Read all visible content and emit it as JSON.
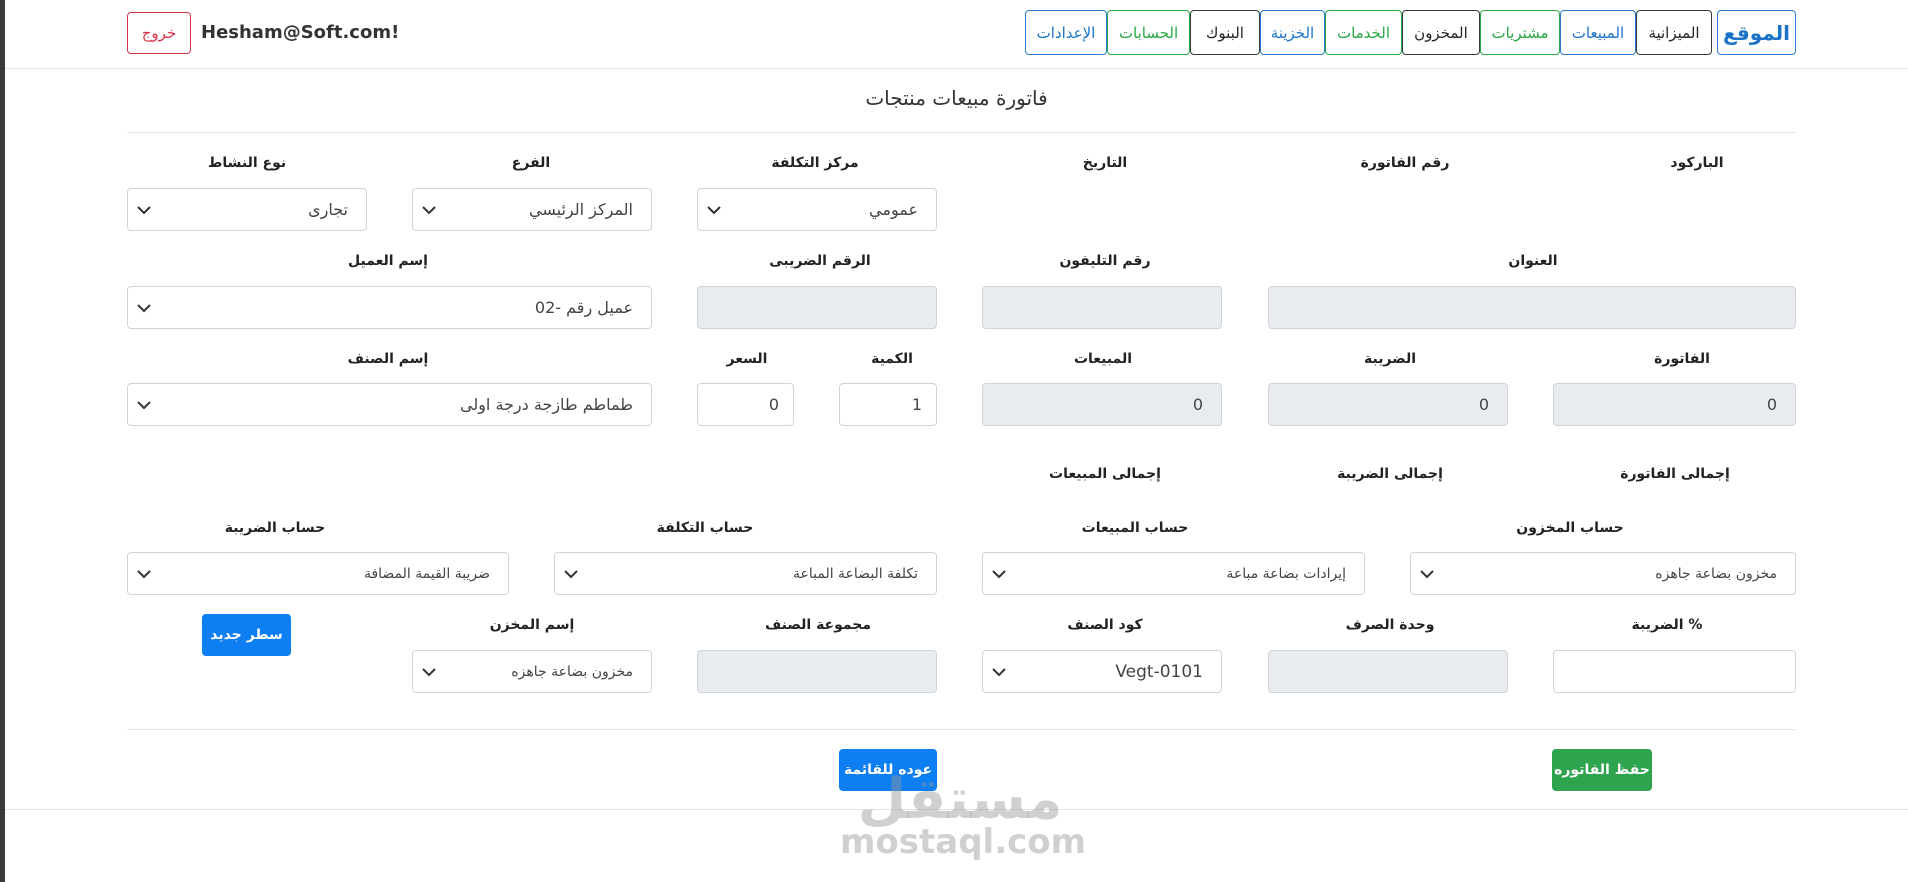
{
  "header": {
    "brand": "الموقع",
    "nav": [
      {
        "label": "الميزانية",
        "name": "nav-budget"
      },
      {
        "label": "المبيعات",
        "name": "nav-sales"
      },
      {
        "label": "مشتريات",
        "name": "nav-purchases"
      },
      {
        "label": "المخزون",
        "name": "nav-inventory"
      },
      {
        "label": "الخدمات",
        "name": "nav-services"
      },
      {
        "label": "الخزينة",
        "name": "nav-treasury"
      },
      {
        "label": "البنوك",
        "name": "nav-banks"
      },
      {
        "label": "الحسابات",
        "name": "nav-accounts"
      },
      {
        "label": "الإعدادات",
        "name": "nav-settings"
      }
    ],
    "user_email": "Hesham@Soft.com!",
    "logout_label": "خروج"
  },
  "form": {
    "title": "فاتورة مبيعات منتجات",
    "labels": {
      "barcode": "الباركود",
      "invoice_number": "رقم الفاتورة",
      "date": "التاريخ",
      "cost_center": "مركز التكلفة",
      "branch": "الفرع",
      "activity_type": "نوع النشاط",
      "address": "العنوان",
      "phone": "رقم التليفون",
      "tax_number": "الرقم الضريبى",
      "customer_name": "إسم العميل",
      "invoice": "الفاتورة",
      "tax": "الضريبة",
      "sales": "المبيعات",
      "quantity": "الكمية",
      "price": "السعر",
      "item_name": "إسم الصنف",
      "invoice_total": "إجمالى الفاتورة",
      "tax_total": "إجمالى الضريبة",
      "sales_total": "إجمالى المبيعات",
      "inventory_account": "حساب المخزون",
      "sales_account": "حساب المبيعات",
      "cost_account": "حساب التكلفة",
      "tax_account": "حساب الضريبة",
      "tax_percent": "الضريبة %",
      "unit": "وحدة الصرف",
      "item_code": "كود الصنف",
      "item_group": "مجموعة الصنف",
      "warehouse_name": "إسم المخزن"
    },
    "values": {
      "cost_center": "عمومي",
      "branch": "المركز الرئيسي",
      "activity_type": "تجارى",
      "customer_name": "عميل رقم -02",
      "invoice": "0",
      "tax": "0",
      "sales": "0",
      "quantity": "1",
      "price": "0",
      "item_name": "طماطم طازجة درجة اولى",
      "inventory_account": "مخزون بضاعة جاهزه",
      "sales_account": "إيرادات بضاعة مباعة",
      "cost_account": "تكلفة البضاعة المباعة",
      "tax_account": "ضريبة القيمة المضافة",
      "item_code": "Vegt-0101",
      "warehouse_name": "مخزون بضاعة جاهزه"
    },
    "buttons": {
      "new_row": "سطر جديد",
      "save_invoice": "حفظ الفاتوره",
      "back_to_list": "عوده للقائمة"
    }
  },
  "watermark": {
    "arabic": "مستقل",
    "latin": "mostaql.com"
  }
}
